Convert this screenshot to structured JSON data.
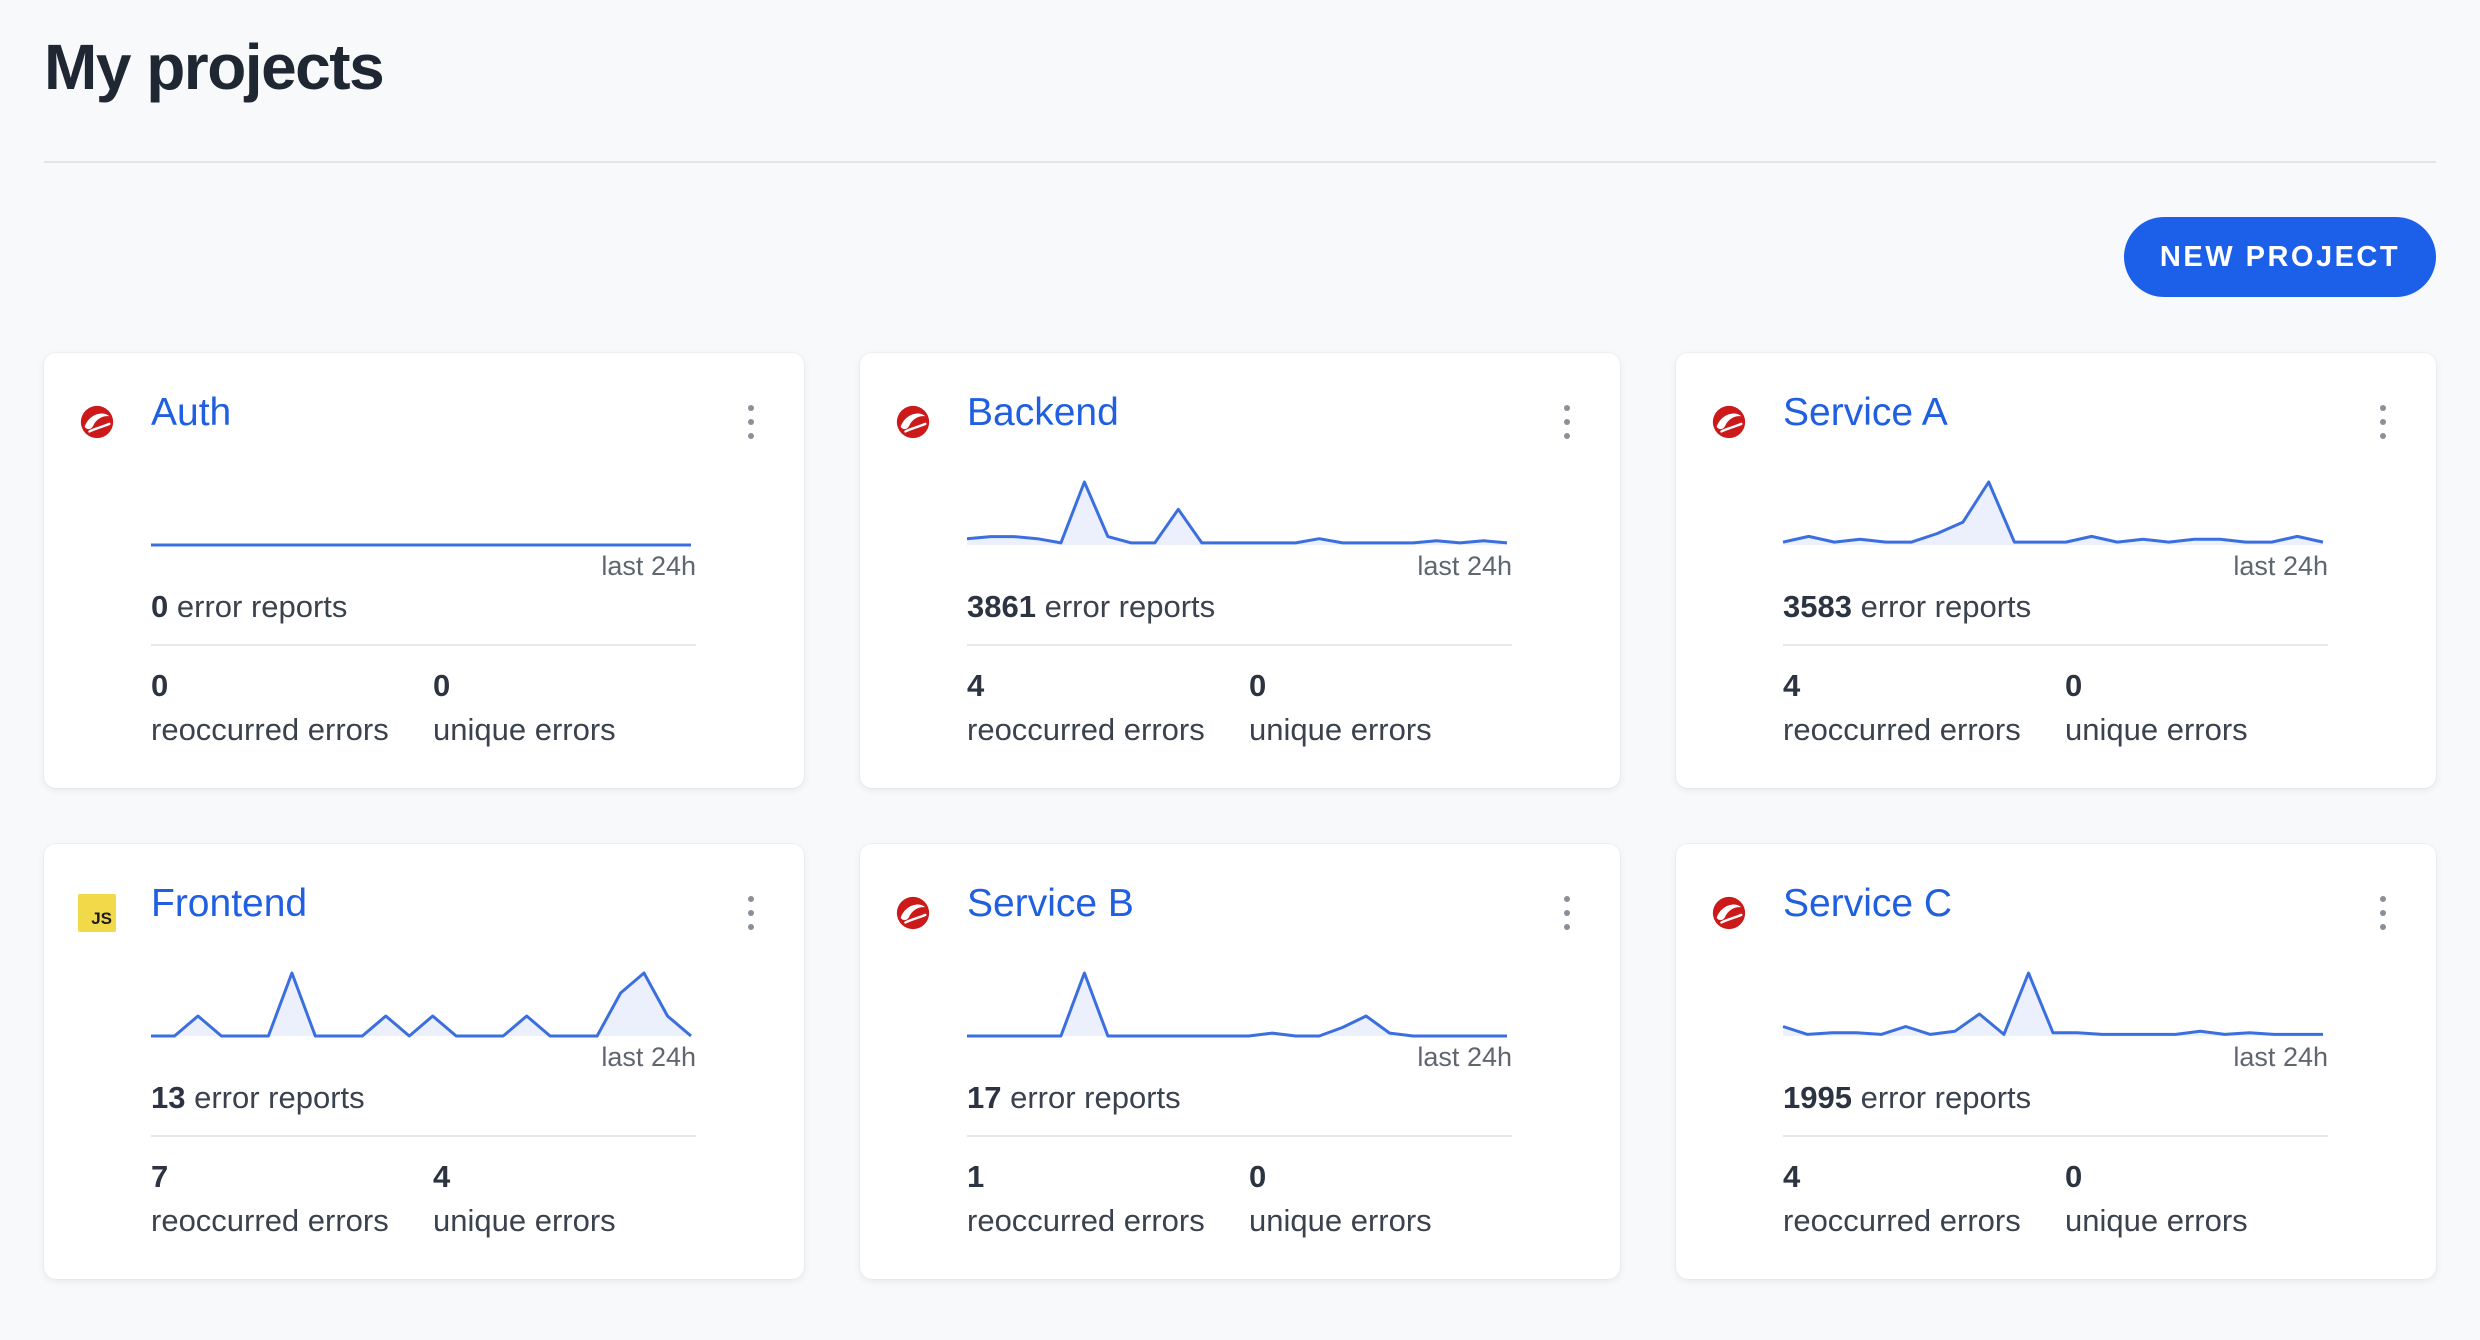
{
  "page": {
    "title": "My projects",
    "new_project_label": "NEW PROJECT"
  },
  "colors": {
    "accent": "#1c5fe8",
    "link": "#1f5fe0",
    "sparkline": "#3b6fe0",
    "ruby_icon": "#cc1a1a",
    "js_icon": "#f2d94a"
  },
  "projects": [
    {
      "name": "Auth",
      "icon": "ruby-icon",
      "icon_text": "",
      "last_label": "last 24h",
      "error_reports": "0",
      "reports_label": "error reports",
      "reoccurred": "0",
      "reoccurred_label": "reoccurred errors",
      "unique": "0",
      "unique_label": "unique errors",
      "sparkline": [
        0,
        0,
        0,
        0,
        0,
        0,
        0,
        0,
        0,
        0,
        0,
        0,
        0,
        0,
        0,
        0,
        0,
        0,
        0,
        0,
        0,
        0,
        0,
        0
      ]
    },
    {
      "name": "Backend",
      "icon": "ruby-icon",
      "icon_text": "",
      "last_label": "last 24h",
      "error_reports": "3861",
      "reports_label": "error reports",
      "reoccurred": "4",
      "reoccurred_label": "reoccurred errors",
      "unique": "0",
      "unique_label": "unique errors",
      "sparkline": [
        3,
        4,
        4,
        3,
        1,
        30,
        4,
        1,
        1,
        17,
        1,
        1,
        1,
        1,
        1,
        3,
        1,
        1,
        1,
        1,
        2,
        1,
        2,
        1
      ]
    },
    {
      "name": "Service A",
      "icon": "ruby-icon",
      "icon_text": "",
      "last_label": "last 24h",
      "error_reports": "3583",
      "reports_label": "error reports",
      "reoccurred": "4",
      "reoccurred_label": "reoccurred errors",
      "unique": "0",
      "unique_label": "unique errors",
      "sparkline": [
        1,
        3,
        1,
        2,
        1,
        1,
        4,
        8,
        22,
        1,
        1,
        1,
        3,
        1,
        2,
        1,
        2,
        2,
        1,
        1,
        3,
        1
      ]
    },
    {
      "name": "Frontend",
      "icon": "js-icon",
      "icon_text": "JS",
      "last_label": "last 24h",
      "error_reports": "13",
      "reports_label": "error reports",
      "reoccurred": "7",
      "reoccurred_label": "reoccurred errors",
      "unique": "4",
      "unique_label": "unique errors",
      "sparkline": [
        0,
        0,
        7,
        0,
        0,
        0,
        22,
        0,
        0,
        0,
        7,
        0,
        7,
        0,
        0,
        0,
        7,
        0,
        0,
        0,
        15,
        22,
        7,
        0
      ]
    },
    {
      "name": "Service B",
      "icon": "ruby-icon",
      "icon_text": "",
      "last_label": "last 24h",
      "error_reports": "17",
      "reports_label": "error reports",
      "reoccurred": "1",
      "reoccurred_label": "reoccurred errors",
      "unique": "0",
      "unique_label": "unique errors",
      "sparkline": [
        0,
        0,
        0,
        0,
        0,
        22,
        0,
        0,
        0,
        0,
        0,
        0,
        0,
        1,
        0,
        0,
        3,
        7,
        1,
        0,
        0,
        0,
        0,
        0
      ]
    },
    {
      "name": "Service C",
      "icon": "ruby-icon",
      "icon_text": "",
      "last_label": "last 24h",
      "error_reports": "1995",
      "reports_label": "error reports",
      "reoccurred": "4",
      "reoccurred_label": "reoccurred errors",
      "unique": "0",
      "unique_label": "unique errors",
      "sparkline": [
        6,
        1,
        2,
        2,
        1,
        6,
        1,
        3,
        14,
        1,
        40,
        2,
        2,
        1,
        1,
        1,
        1,
        3,
        1,
        2,
        1,
        1,
        1
      ]
    }
  ]
}
